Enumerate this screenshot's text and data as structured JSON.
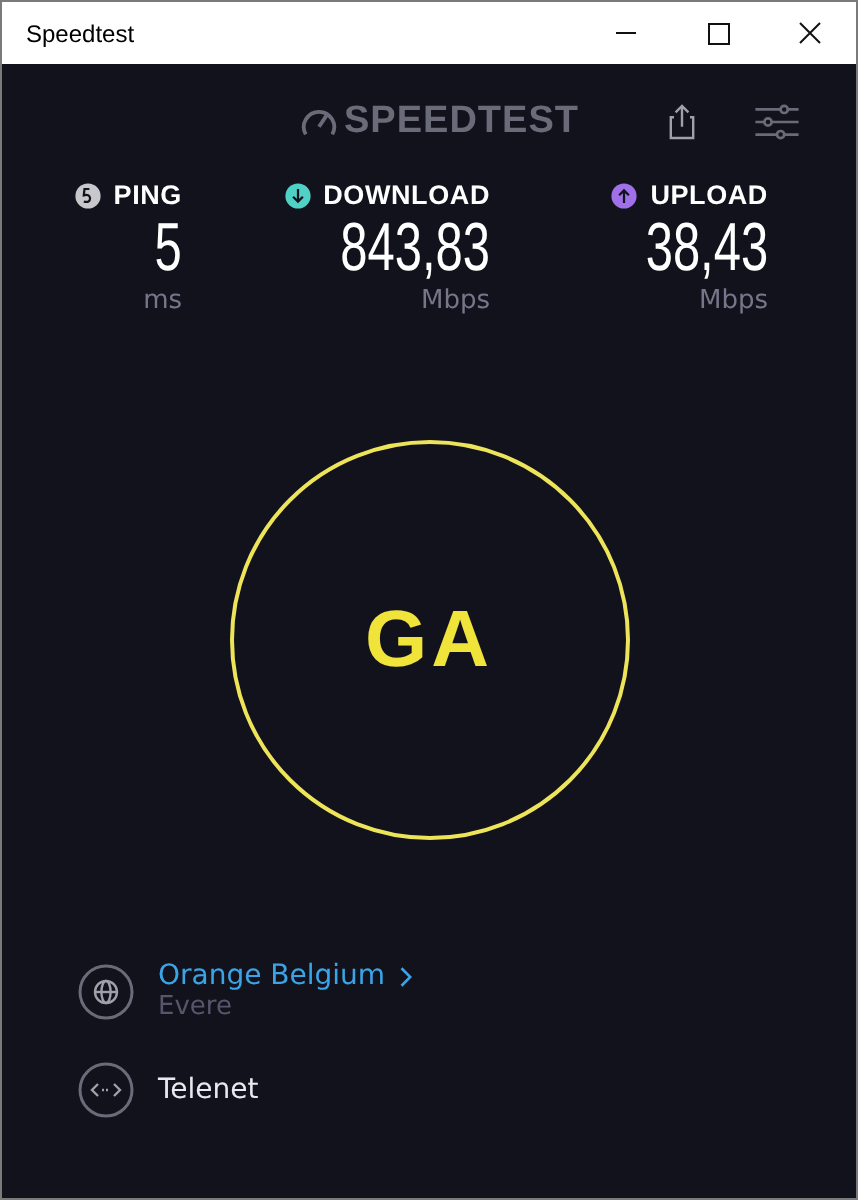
{
  "window": {
    "title": "Speedtest"
  },
  "header": {
    "logo": "SPEEDTEST"
  },
  "metrics": [
    {
      "kind": "ping",
      "label": "PING",
      "value": "5",
      "unit": "ms",
      "color": "#c8c8cc"
    },
    {
      "kind": "download",
      "label": "DOWNLOAD",
      "value": "843,83",
      "unit": "Mbps",
      "color": "#4fd1c5"
    },
    {
      "kind": "upload",
      "label": "UPLOAD",
      "value": "38,43",
      "unit": "Mbps",
      "color": "#a070e8"
    }
  ],
  "go_button": {
    "label": "GA"
  },
  "connections": [
    {
      "kind": "server",
      "name": "Orange Belgium",
      "location": "Evere"
    },
    {
      "kind": "provider",
      "name": "Telenet"
    }
  ]
}
